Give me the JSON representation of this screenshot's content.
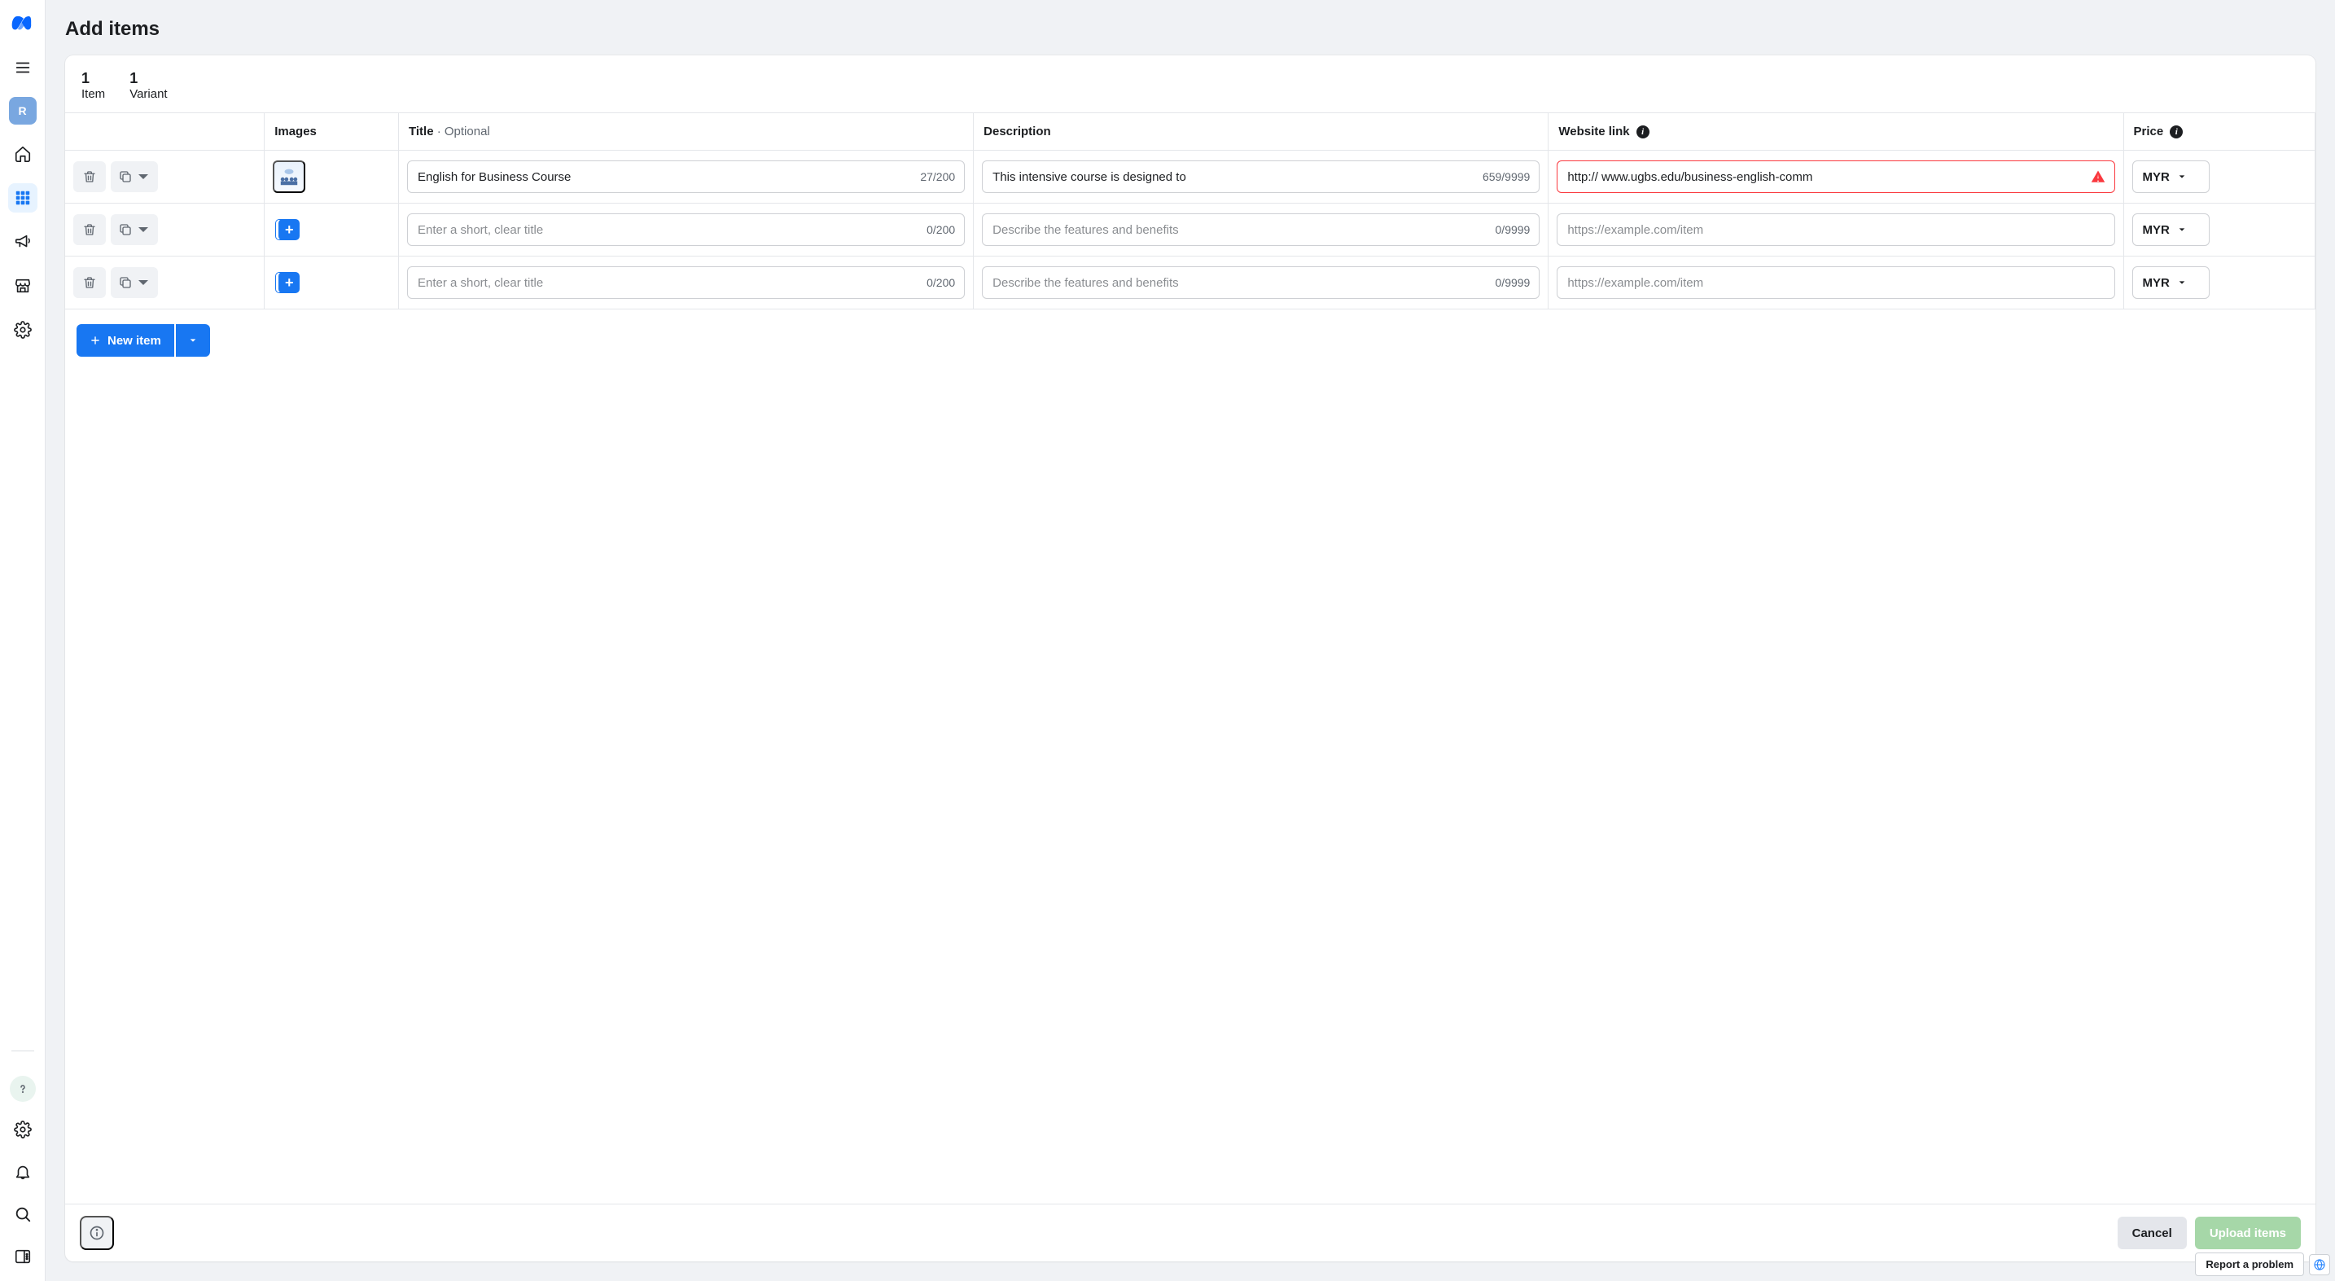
{
  "page": {
    "title": "Add items"
  },
  "avatar_letter": "R",
  "counts": {
    "items": {
      "num": "1",
      "label": "Item"
    },
    "variants": {
      "num": "1",
      "label": "Variant"
    }
  },
  "columns": {
    "images": "Images",
    "title": "Title",
    "title_optional": " · Optional",
    "description": "Description",
    "website_link": "Website link",
    "price": "Price"
  },
  "rows": [
    {
      "title_value": "English for Business Course",
      "title_counter": "27/200",
      "desc_value": "This intensive course is designed to",
      "desc_counter": "659/9999",
      "link_value": "http:// www.ugbs.edu/business-english-comm",
      "link_error": true,
      "currency": "MYR",
      "has_image": true
    },
    {
      "title_value": "",
      "title_counter": "0/200",
      "desc_value": "",
      "desc_counter": "0/9999",
      "link_value": "",
      "link_error": false,
      "currency": "MYR",
      "has_image": false
    },
    {
      "title_value": "",
      "title_counter": "0/200",
      "desc_value": "",
      "desc_counter": "0/9999",
      "link_value": "",
      "link_error": false,
      "currency": "MYR",
      "has_image": false
    }
  ],
  "placeholders": {
    "title": "Enter a short, clear title",
    "desc": "Describe the features and benefits",
    "link": "https://example.com/item"
  },
  "buttons": {
    "new_item": "New item",
    "cancel": "Cancel",
    "upload": "Upload items"
  },
  "corner": {
    "report": "Report a problem"
  }
}
